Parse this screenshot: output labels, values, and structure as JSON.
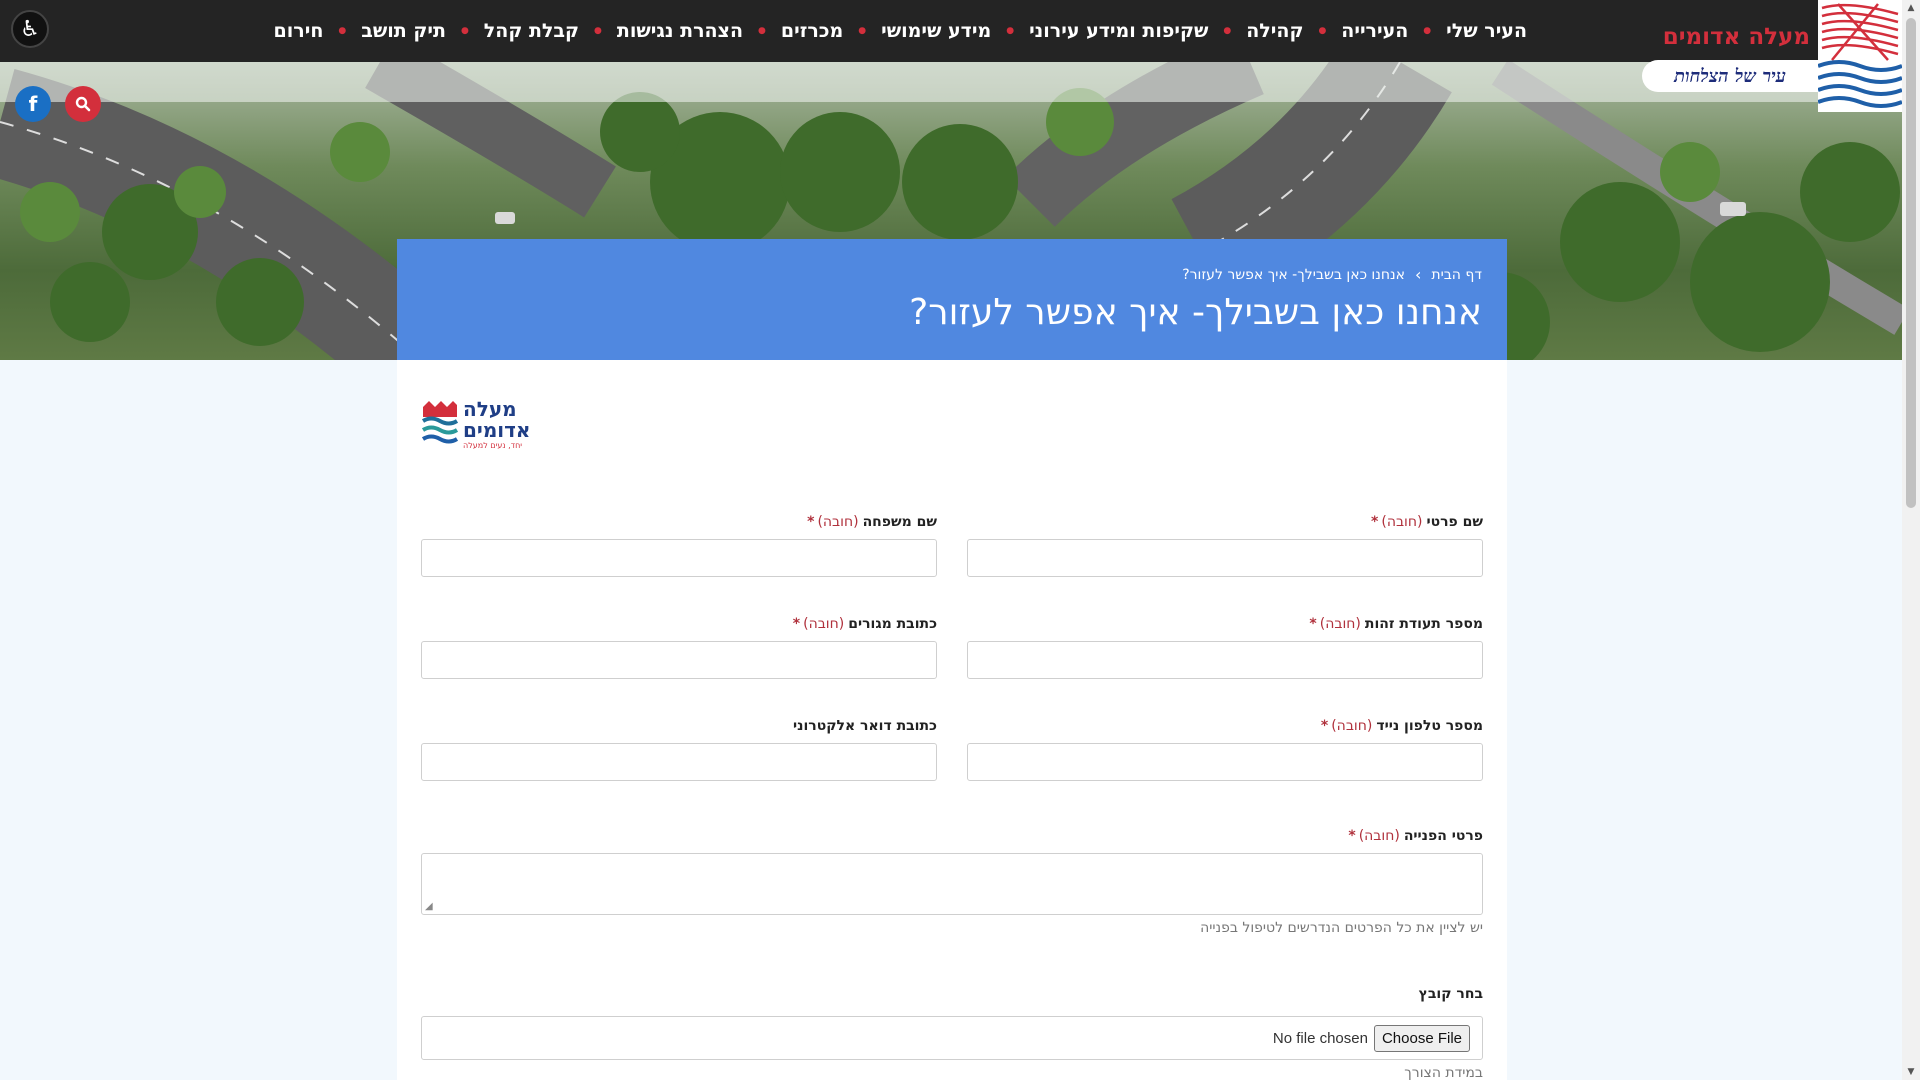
{
  "nav": {
    "items": [
      {
        "label": "העיר שלי"
      },
      {
        "label": "העירייה"
      },
      {
        "label": "קהילה"
      },
      {
        "label": "שקיפות ומידע עירוני"
      },
      {
        "label": "מידע שימושי"
      },
      {
        "label": "מכרזים"
      },
      {
        "label": "הצהרת נגישות"
      },
      {
        "label": "קבלת קהל"
      },
      {
        "label": "תיק תושב"
      },
      {
        "label": "חירום"
      }
    ]
  },
  "brand": {
    "name": "מעלה אדומים",
    "slogan": "עיר של הצלחות"
  },
  "social": {
    "facebook_glyph": "f"
  },
  "page": {
    "breadcrumb_home": "דף הבית",
    "breadcrumb_current": "אנחנו כאן בשבילך- איך אפשר לעזור?",
    "title": "אנחנו כאן בשבילך- איך אפשר לעזור?"
  },
  "org_logo": {
    "line1": "מעלה",
    "line2": "אדומים",
    "tagline": "יחד, נעים למעלה"
  },
  "form": {
    "required_text": "(חובה)",
    "required_star": "*",
    "first_name_label": "שם פרטי",
    "last_name_label": "שם משפחה",
    "id_label": "מספר תעודת זהות",
    "address_label": "כתובת מגורים",
    "phone_label": "מספר טלפון נייד",
    "email_label": "כתובת דואר אלקטרוני",
    "details_label": "פרטי הפנייה",
    "details_hint": "יש לציין את כל הפרטים הנדרשים לטיפול בפנייה",
    "file_label": "בחר קובץ",
    "file_button": "Choose File",
    "file_status": "No file chosen",
    "file_hint": "במידת הצורך"
  },
  "colors": {
    "nav_bg": "#242424",
    "accent_red": "#d32f3c",
    "title_band": "#5088e0",
    "page_bg": "#f2f8fd"
  },
  "icons": [
    "accessibility-icon",
    "facebook-icon",
    "search-icon",
    "chevron-left-icon",
    "resize-grip-icon"
  ]
}
